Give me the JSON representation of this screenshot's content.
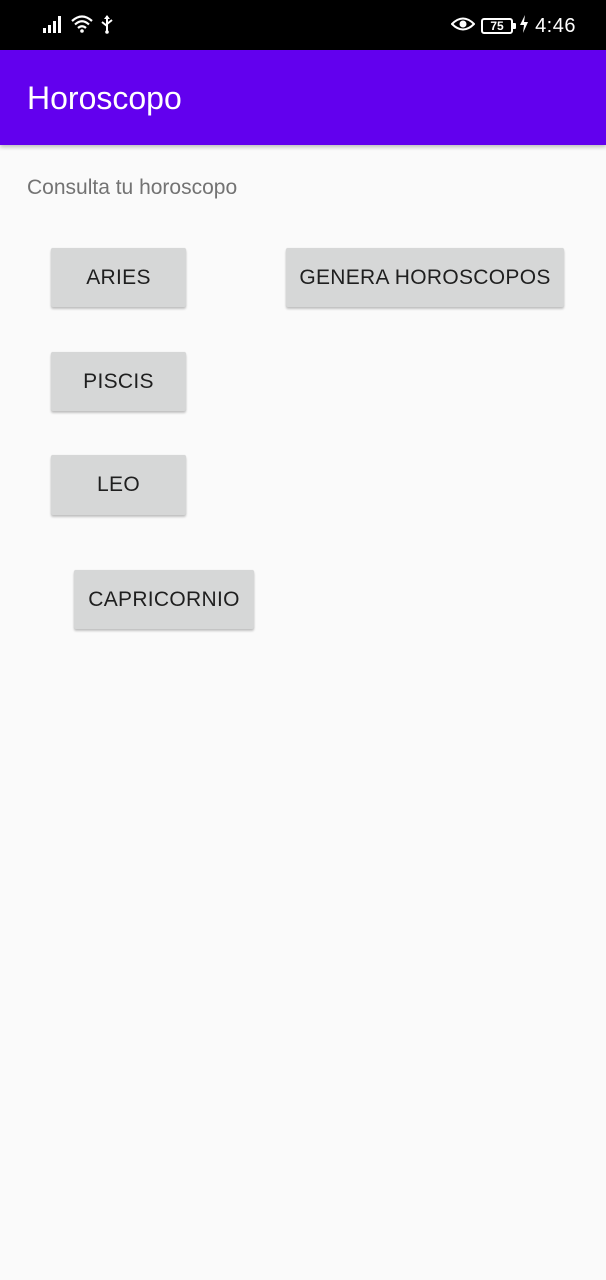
{
  "status_bar": {
    "time": "4:46",
    "battery": "75",
    "icons": [
      "signal-icon",
      "wifi-icon",
      "usb-icon",
      "eye-icon",
      "battery-icon",
      "charging-icon"
    ]
  },
  "app_bar": {
    "title": "Horoscopo",
    "color": "#6200ee"
  },
  "main": {
    "subtitle": "Consulta tu horoscopo",
    "buttons": {
      "aries": "ARIES",
      "piscis": "PISCIS",
      "leo": "LEO",
      "capricornio": "CAPRICORNIO",
      "genera": "GENERA HOROSCOPOS"
    }
  }
}
